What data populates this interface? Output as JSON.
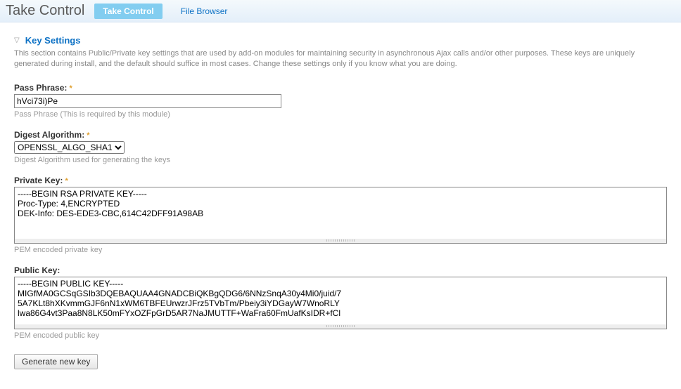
{
  "header": {
    "title": "Take Control",
    "tabs": [
      {
        "label": "Take Control",
        "active": true
      },
      {
        "label": "File Browser",
        "active": false
      }
    ]
  },
  "section": {
    "title": "Key Settings",
    "description": "This section contains Public/Private key settings that are used by add-on modules for maintaining security in asynchronous Ajax calls and/or other purposes. These keys are uniquely generated during install, and the default should suffice in most cases. Change these settings only if you know what you are doing."
  },
  "fields": {
    "pass_phrase": {
      "label": "Pass Phrase:",
      "value": "hVci73i)Pe",
      "hint": "Pass Phrase (This is required by this module)",
      "required": true
    },
    "digest": {
      "label": "Digest Algorithm:",
      "value": "OPENSSL_ALGO_SHA1",
      "hint": "Digest Algorithm used for generating the keys",
      "required": true
    },
    "private_key": {
      "label": "Private Key:",
      "value": "-----BEGIN RSA PRIVATE KEY-----\nProc-Type: 4,ENCRYPTED\nDEK-Info: DES-EDE3-CBC,614C42DFF91A98AB\n",
      "hint": "PEM encoded private key",
      "required": true
    },
    "public_key": {
      "label": "Public Key:",
      "value": "-----BEGIN PUBLIC KEY-----\nMIGfMA0GCSqGSIb3DQEBAQUAA4GNADCBiQKBgQDG6/6NNzSnqA30y4Mi0/juid/7\n5A7KLt8hXKvmmGJF6nN1xWM6TBFEUrwzrJFrz5TVbTm/Pbeiy3iYDGayW7WnoRLY\nlwa86G4vt3Paa8N8LK50mFYxOZFpGrD5AR7NaJMUTTF+WaFra60FmUafKsIDR+fCl",
      "hint": "PEM encoded public key",
      "required": false
    }
  },
  "buttons": {
    "generate": "Generate new key"
  },
  "required_marker": "*"
}
